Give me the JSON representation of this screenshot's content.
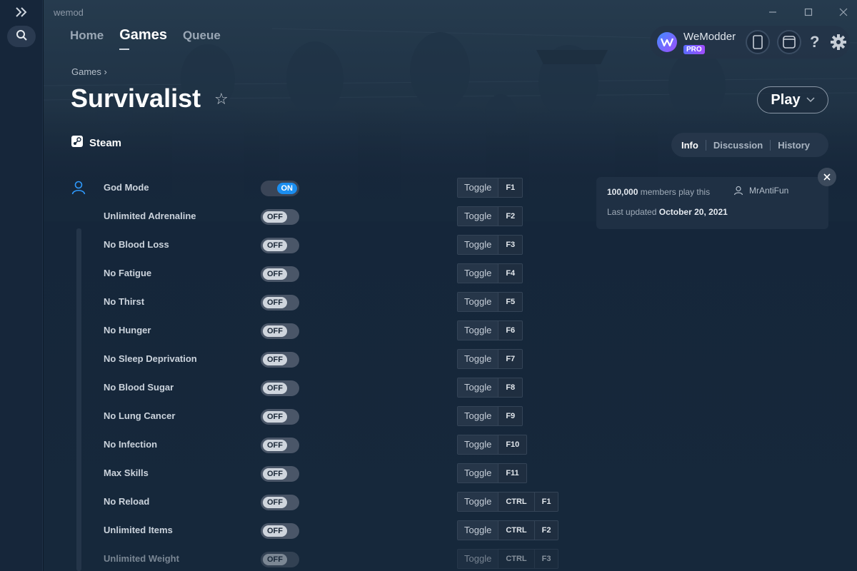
{
  "app": {
    "title": "wemod"
  },
  "nav": {
    "home": "Home",
    "games": "Games",
    "queue": "Queue"
  },
  "account": {
    "username": "WeModder",
    "badge": "PRO",
    "help": "?"
  },
  "breadcrumb": {
    "label": "Games",
    "separator": "›"
  },
  "game": {
    "title": "Survivalist",
    "platform": "Steam"
  },
  "play": {
    "label": "Play"
  },
  "tabs": {
    "info": "Info",
    "discussion": "Discussion",
    "history": "History"
  },
  "info": {
    "member_count": "100,000",
    "member_suffix": "members play this",
    "author": "MrAntiFun",
    "updated_prefix": "Last updated",
    "updated_date": "October 20, 2021"
  },
  "toggle_labels": {
    "on": "ON",
    "off": "OFF"
  },
  "hotkey_action": "Toggle",
  "cheats": [
    {
      "name": "God Mode",
      "state": "ON",
      "keys": [
        "F1"
      ]
    },
    {
      "name": "Unlimited Adrenaline",
      "state": "OFF",
      "keys": [
        "F2"
      ]
    },
    {
      "name": "No Blood Loss",
      "state": "OFF",
      "keys": [
        "F3"
      ]
    },
    {
      "name": "No Fatigue",
      "state": "OFF",
      "keys": [
        "F4"
      ]
    },
    {
      "name": "No Thirst",
      "state": "OFF",
      "keys": [
        "F5"
      ]
    },
    {
      "name": "No Hunger",
      "state": "OFF",
      "keys": [
        "F6"
      ]
    },
    {
      "name": "No Sleep Deprivation",
      "state": "OFF",
      "keys": [
        "F7"
      ]
    },
    {
      "name": "No Blood Sugar",
      "state": "OFF",
      "keys": [
        "F8"
      ]
    },
    {
      "name": "No Lung Cancer",
      "state": "OFF",
      "keys": [
        "F9"
      ]
    },
    {
      "name": "No Infection",
      "state": "OFF",
      "keys": [
        "F10"
      ]
    },
    {
      "name": "Max Skills",
      "state": "OFF",
      "keys": [
        "F11"
      ]
    },
    {
      "name": "No Reload",
      "state": "OFF",
      "keys": [
        "CTRL",
        "F1"
      ]
    },
    {
      "name": "Unlimited Items",
      "state": "OFF",
      "keys": [
        "CTRL",
        "F2"
      ]
    },
    {
      "name": "Unlimited Weight",
      "state": "OFF",
      "keys": [
        "CTRL",
        "F3"
      ]
    }
  ],
  "colors": {
    "accent": "#1b8ef0",
    "background": "#16283b",
    "rail": "#16263a"
  }
}
